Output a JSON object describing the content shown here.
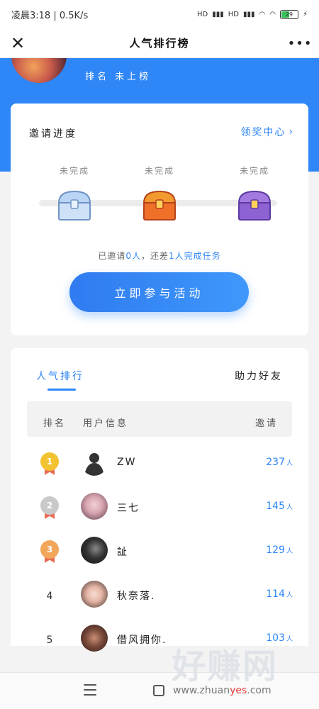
{
  "status_bar": {
    "time": "凌晨3:18",
    "speed": "0.5K/s",
    "network1": "HD",
    "network2": "HD",
    "battery": "29"
  },
  "nav": {
    "title": "人气排行榜",
    "close_icon": "close-icon",
    "more_icon": "more-icon"
  },
  "header": {
    "rank_label": "排名 未上榜"
  },
  "progress": {
    "title": "邀请进度",
    "reward_link": "领奖中心",
    "steps": [
      {
        "label": "未完成",
        "chest": "silver-chest-icon",
        "color": "#a9c8ee"
      },
      {
        "label": "未完成",
        "chest": "orange-chest-icon",
        "color": "#f08a2a"
      },
      {
        "label": "未完成",
        "chest": "purple-chest-icon",
        "color": "#9a6ad8"
      }
    ],
    "invite_prefix": "已邀请",
    "invited": "0",
    "unit": "人",
    "invite_mid": "，还差",
    "remaining": "1",
    "remaining_suffix": "人完成任务",
    "join_button": "立即参与活动"
  },
  "ranking": {
    "tab_popular": "人气排行",
    "tab_friends": "助力好友",
    "columns": {
      "rank": "排名",
      "user": "用户信息",
      "invites": "邀请"
    },
    "rows": [
      {
        "rank": "1",
        "medal": "gold",
        "name": "ZW",
        "count": "237",
        "unit": "人"
      },
      {
        "rank": "2",
        "medal": "silver",
        "name": "三七",
        "count": "145",
        "unit": "人"
      },
      {
        "rank": "3",
        "medal": "bronze",
        "name": "訨",
        "count": "129",
        "unit": "人"
      },
      {
        "rank": "4",
        "medal": "",
        "name": "秋奈落.",
        "count": "114",
        "unit": "人"
      },
      {
        "rank": "5",
        "medal": "",
        "name": "借风拥你.",
        "count": "103",
        "unit": "人"
      }
    ]
  },
  "watermark": {
    "big": "好赚网",
    "site_prefix": "www.zhuan",
    "site_highlight": "yes",
    "site_suffix": ".com"
  },
  "colors": {
    "accent": "#2f86f6",
    "gold": "#f2c230",
    "silver": "#c9c9c9",
    "bronze": "#f1a65a"
  }
}
